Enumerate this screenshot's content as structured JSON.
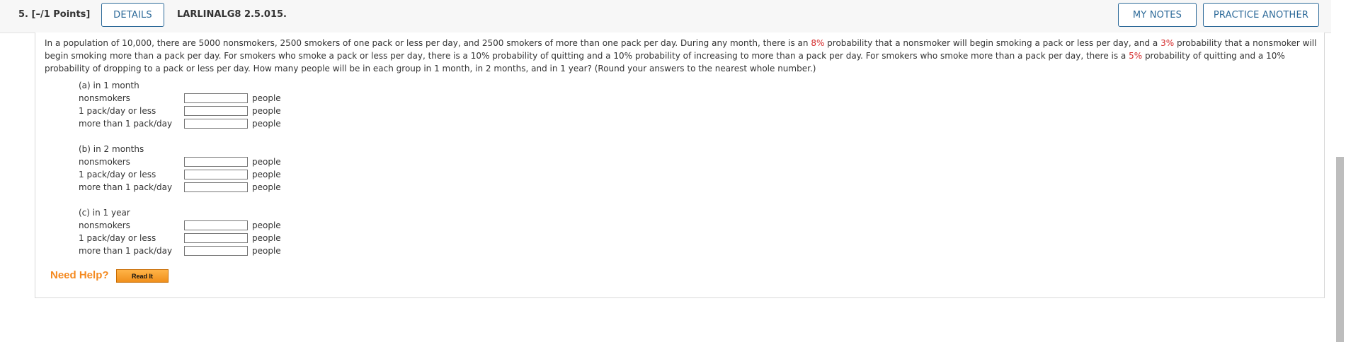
{
  "header": {
    "question_number": "5.  [–/1 Points]",
    "details_label": "DETAILS",
    "question_code": "LARLINALG8 2.5.015.",
    "my_notes_label": "MY NOTES",
    "practice_label": "PRACTICE ANOTHER"
  },
  "problem": {
    "text_1": "In a population of 10,000, there are 5000 nonsmokers, 2500 smokers of one pack or less per day, and 2500 smokers of more than one pack per day. During any month, there is an ",
    "highlight_1": "8%",
    "text_2": " probability that a nonsmoker will begin smoking a pack or less per day, and a ",
    "highlight_2": "3%",
    "text_3": " probability that a nonsmoker will begin smoking more than a pack per day. For smokers who smoke a pack or less per day, there is a 10% probability of quitting and a 10% probability of increasing to more than a pack per day. For smokers who smoke more than a pack per day, there is a ",
    "highlight_3": "5%",
    "text_4": " probability of quitting and a 10% probability of dropping to a pack or less per day. How many people will be in each group in 1 month, in 2 months, and in 1 year? (Round your answers to the nearest whole number.)"
  },
  "parts": [
    {
      "title": "(a) in 1 month",
      "rows": [
        {
          "label": "nonsmokers",
          "value": "",
          "unit": "people"
        },
        {
          "label": "1 pack/day or less",
          "value": "",
          "unit": "people"
        },
        {
          "label": "more than 1 pack/day",
          "value": "",
          "unit": "people"
        }
      ]
    },
    {
      "title": "(b) in 2 months",
      "rows": [
        {
          "label": "nonsmokers",
          "value": "",
          "unit": "people"
        },
        {
          "label": "1 pack/day or less",
          "value": "",
          "unit": "people"
        },
        {
          "label": "more than 1 pack/day",
          "value": "",
          "unit": "people"
        }
      ]
    },
    {
      "title": "(c) in 1 year",
      "rows": [
        {
          "label": "nonsmokers",
          "value": "",
          "unit": "people"
        },
        {
          "label": "1 pack/day or less",
          "value": "",
          "unit": "people"
        },
        {
          "label": "more than 1 pack/day",
          "value": "",
          "unit": "people"
        }
      ]
    }
  ],
  "help": {
    "need_help_label": "Need Help?",
    "read_it_label": "Read It"
  },
  "colors": {
    "accent": "#2d6a99",
    "highlight": "#d42a2a",
    "help": "#f4891f"
  }
}
